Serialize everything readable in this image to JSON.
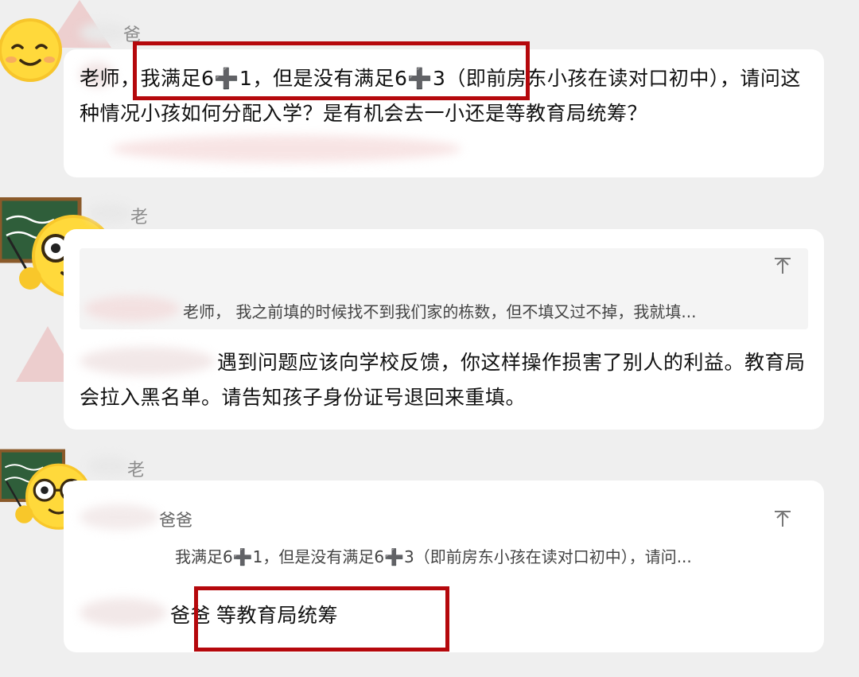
{
  "messages": [
    {
      "sender": "爸爸",
      "text": "老师，我满足6➕1，但是没有满足6➕3（即前房东小孩在读对口初中），请问这种情况小孩如何分配入学？是有机会去一小还是等教育局统筹？"
    },
    {
      "sender": "老师",
      "quote": "老师， 我之前填的时候找不到我们家的栋数，但不填又过不掉，我就填...",
      "text": "遇到问题应该向学校反馈，你这样操作损害了别人的利益。教育局会拉入黑名单。请告知孩子身份证号退回来重填。"
    },
    {
      "sender": "老师",
      "quote_sender": "爸爸",
      "quote": "我满足6➕1，但是没有满足6➕3（即前房东小孩在读对口初中），请问...",
      "reply_prefix": "爸爸",
      "text": "等教育局统筹"
    }
  ],
  "icons": {
    "pin": "pin-to-top-icon",
    "parent_avatar": "smiley-face-avatar",
    "teacher_avatar": "teacher-glasses-emoji-avatar"
  },
  "colors": {
    "highlight": "#b5080c",
    "background": "#efefef",
    "bubble": "#ffffff"
  }
}
